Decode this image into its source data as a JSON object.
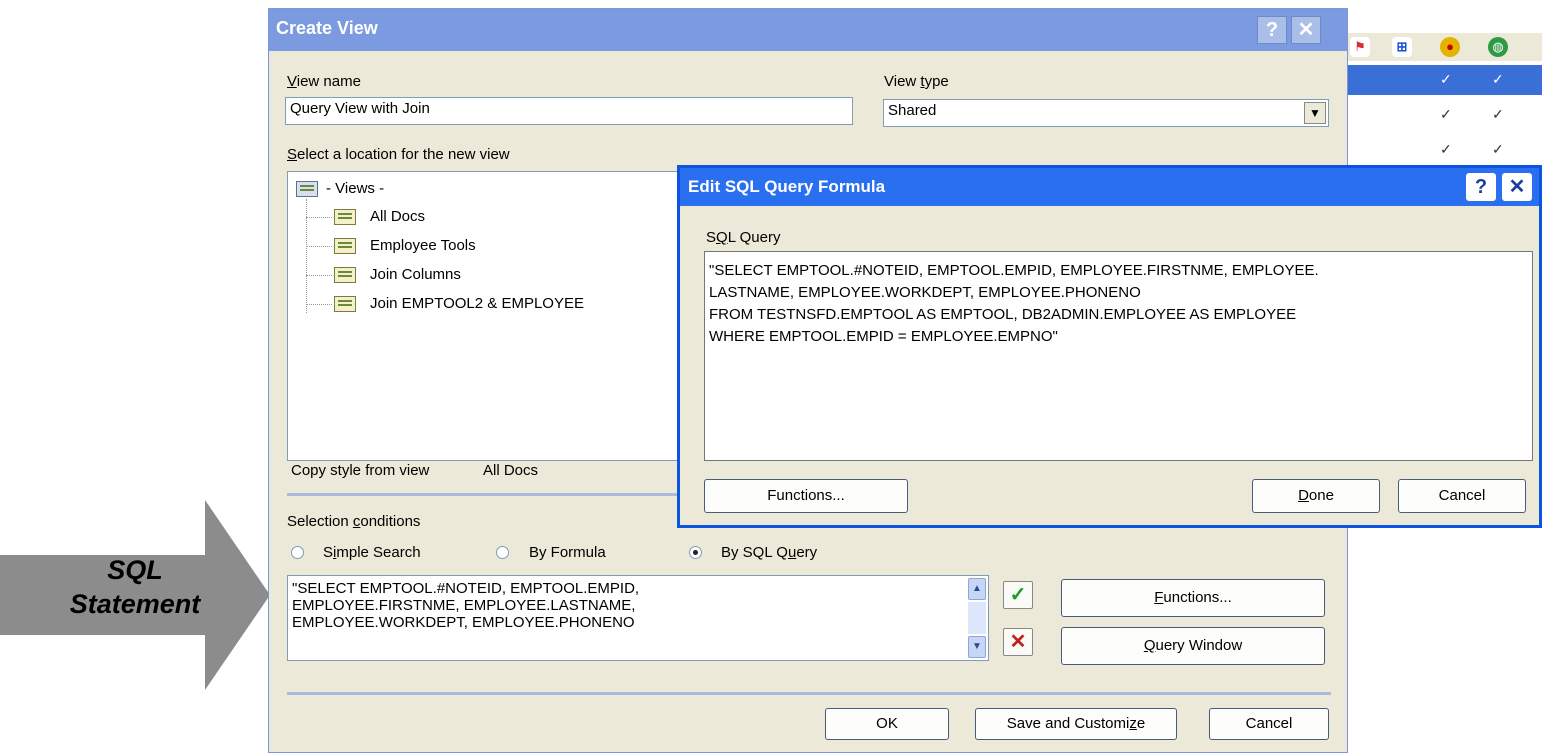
{
  "arrow": {
    "line1": "SQL",
    "line2": "Statement"
  },
  "create_view": {
    "title": "Create View",
    "help_label": "?",
    "close_label": "✕",
    "view_name_label_u": "V",
    "view_name_label_rest": "iew name",
    "view_name_value": "Query View with Join",
    "view_type_label_pre": "View ",
    "view_type_label_u": "t",
    "view_type_label_rest": "ype",
    "view_type_value": "Shared",
    "location_label_u": "S",
    "location_label_rest": "elect a location for the new view",
    "tree": {
      "root": "- Views -",
      "items": [
        "All Docs",
        "Employee Tools",
        "Join Columns",
        "Join EMPTOOL2 & EMPLOYEE"
      ]
    },
    "copy_style_label": "Copy style from view",
    "copy_style_value": "All Docs",
    "selection_label_pre": "Selection ",
    "selection_label_u": "c",
    "selection_label_rest": "onditions",
    "radios": {
      "simple_pre": "S",
      "simple_u": "i",
      "simple_rest": "mple Search",
      "formula": "By Formula",
      "sql_pre": "By SQL Q",
      "sql_u": "u",
      "sql_rest": "ery"
    },
    "formula_lines": [
      "\"SELECT EMPTOOL.#NOTEID, EMPTOOL.EMPID,",
      "EMPLOYEE.FIRSTNME, EMPLOYEE.LASTNAME,",
      "EMPLOYEE.WORKDEPT, EMPLOYEE.PHONENO"
    ],
    "functions_u": "F",
    "functions_rest": "unctions...",
    "query_window_u": "Q",
    "query_window_rest": "uery Window",
    "ok_label": "OK",
    "save_customize_pre": "Save and Customi",
    "save_customize_u": "z",
    "save_customize_rest": "e",
    "cancel_label": "Cancel"
  },
  "sql_dialog": {
    "title": "Edit SQL Query Formula",
    "help_label": "?",
    "close_label": "✕",
    "query_label_pre": "S",
    "query_label_u": "Q",
    "query_label_rest": "L Query",
    "query_lines": [
      "\"SELECT EMPTOOL.#NOTEID, EMPTOOL.EMPID, EMPLOYEE.FIRSTNME, EMPLOYEE.",
      "LASTNAME, EMPLOYEE.WORKDEPT, EMPLOYEE.PHONENO",
      "FROM TESTNSFD.EMPTOOL AS EMPTOOL, DB2ADMIN.EMPLOYEE AS EMPLOYEE",
      "WHERE EMPTOOL.EMPID = EMPLOYEE.EMPNO\""
    ],
    "functions_label": "Functions...",
    "done_u": "D",
    "done_rest": "one",
    "cancel_label": "Cancel"
  },
  "background": {
    "check_glyph": "✓",
    "toolbar_icons": [
      "flag-icon",
      "grid-icon",
      "badge-icon",
      "globe-icon"
    ]
  },
  "colors": {
    "create_view_title": "#7b9ae0",
    "sql_title": "#2a6ff0",
    "selected_row": "#3a6fd8",
    "dialog_face": "#ece9d8"
  }
}
